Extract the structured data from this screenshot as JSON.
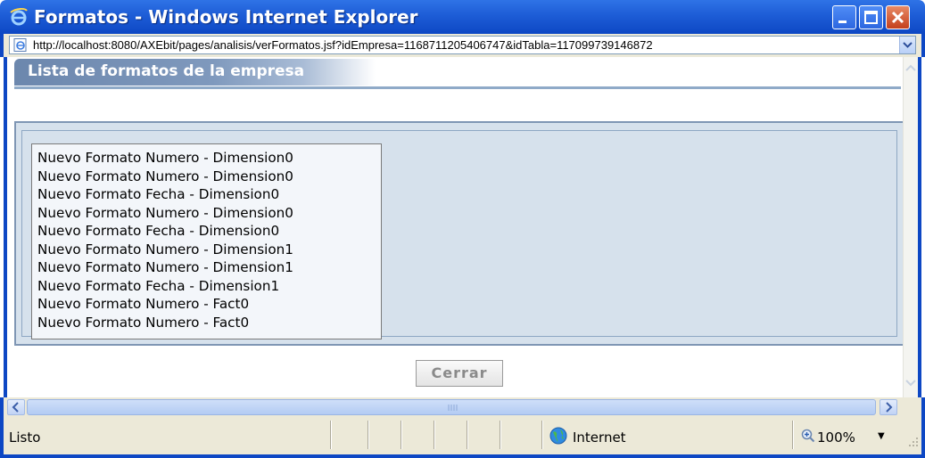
{
  "window": {
    "title": "Formatos - Windows Internet Explorer",
    "icon": "ie-icon",
    "buttons": [
      "minimize-icon",
      "maximize-icon",
      "close-icon"
    ]
  },
  "address": {
    "url": "http://localhost:8080/AXEbit/pages/analisis/verFormatos.jsf?idEmpresa=1168711205406747&idTabla=117099739146872"
  },
  "page": {
    "header_title": "Lista de formatos de la empresa",
    "formats": [
      "Nuevo Formato Numero - Dimension0",
      "Nuevo Formato Numero - Dimension0",
      "Nuevo Formato Fecha - Dimension0",
      "Nuevo Formato Numero - Dimension0",
      "Nuevo Formato Fecha - Dimension0",
      "Nuevo Formato Numero - Dimension1",
      "Nuevo Formato Numero - Dimension1",
      "Nuevo Formato Fecha - Dimension1",
      "Nuevo Formato Numero - Fact0",
      "Nuevo Formato Numero - Fact0"
    ],
    "close_button": "Cerrar"
  },
  "status": {
    "text": "Listo",
    "zone": "Internet",
    "zoom": "100%"
  },
  "colors": {
    "titlebar": "#0d47c4",
    "header_band": "#7f99bd",
    "panel_bg": "#d6e1ec"
  }
}
